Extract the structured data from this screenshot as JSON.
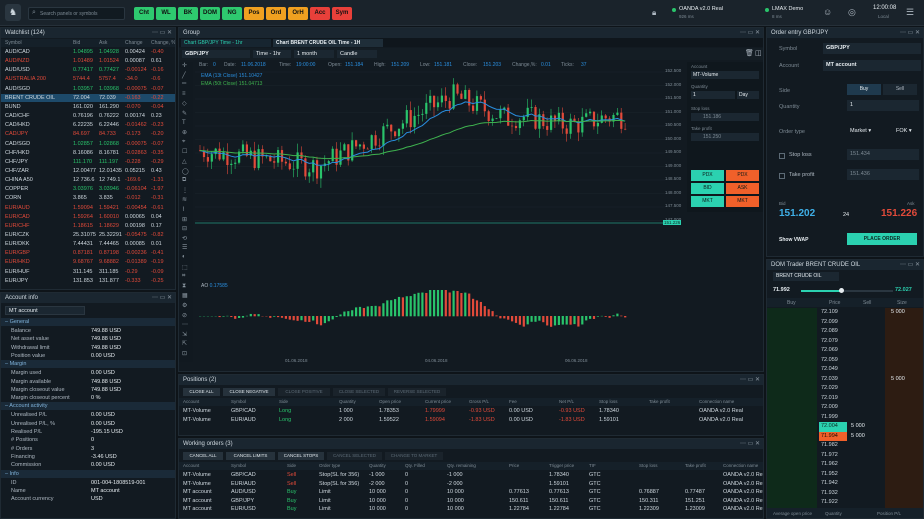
{
  "topbar": {
    "search_placeholder": "Search panels or symbols",
    "buttons": [
      {
        "label": "Cht",
        "color": "#2ec96f"
      },
      {
        "label": "WL",
        "color": "#2ec96f"
      },
      {
        "label": "BK",
        "color": "#2ec96f"
      },
      {
        "label": "DOM",
        "color": "#2ec96f"
      },
      {
        "label": "NG",
        "color": "#2ec96f"
      },
      {
        "label": "Pos",
        "color": "#f0a020"
      },
      {
        "label": "Ord",
        "color": "#f0a020"
      },
      {
        "label": "OrH",
        "color": "#f0a020"
      },
      {
        "label": "Acc",
        "color": "#e8403a"
      },
      {
        "label": "Sym",
        "color": "#e8403a"
      }
    ],
    "conn1": {
      "name": "OANDA v2.0 Real",
      "sub": "926 ms"
    },
    "conn2": {
      "name": "LMAX Demo",
      "sub": "8 ms"
    },
    "time": "12:00:08",
    "time_sub": "Local"
  },
  "watchlist": {
    "title": "Watchlist (124)",
    "cols": [
      "Symbol",
      "Bid",
      "Ask",
      "Change",
      "Change, %"
    ],
    "rows": [
      [
        "AUD/CAD",
        "1.04895",
        "1.04928",
        "0.00424",
        "-0.40",
        "g"
      ],
      [
        "AUD/NZD",
        "1.01489",
        "1.01524",
        "0.00087",
        "0.61",
        "r"
      ],
      [
        "AUD/USD",
        "0.77417",
        "0.77427",
        "-0.00124",
        "-0.16",
        "g"
      ],
      [
        "AUSTRALIA 200",
        "5744.4",
        "5757.4",
        "-34.0",
        "-0.6",
        "r"
      ],
      [
        "AUD/SGD",
        "1.03957",
        "1.03968",
        "-0.00075",
        "-0.07",
        "g"
      ],
      [
        "BRENT CRUDE OIL",
        "72.004",
        "72.039",
        "-0.163",
        "-0.22",
        "h"
      ],
      [
        "BUND",
        "161.020",
        "161.290",
        "-0.070",
        "-0.04",
        "n"
      ],
      [
        "CAD/CHF",
        "0.76196",
        "0.76222",
        "0.00174",
        "0.23",
        "n"
      ],
      [
        "CAD/HKD",
        "6.22235",
        "6.22446",
        "-0.01462",
        "-0.23",
        "n"
      ],
      [
        "CAD/JPY",
        "84.697",
        "84.733",
        "-0.173",
        "-0.20",
        "r"
      ],
      [
        "CAD/SGD",
        "1.02857",
        "1.02868",
        "-0.00075",
        "-0.07",
        "g"
      ],
      [
        "CHF/HKD",
        "8.16086",
        "8.16781",
        "-0.02863",
        "-0.35",
        "n"
      ],
      [
        "CHF/JPY",
        "111.170",
        "111.197",
        "-0.228",
        "-0.29",
        "g"
      ],
      [
        "CHF/ZAR",
        "12.00477",
        "12.01435",
        "0.05215",
        "0.43",
        "n"
      ],
      [
        "CHINA A50",
        "12 736.6",
        "12 749.1",
        "-169.6",
        "-1.31",
        "n"
      ],
      [
        "COPPER",
        "3.03976",
        "3.03946",
        "-0.06104",
        "-1.97",
        "g"
      ],
      [
        "CORN",
        "3.865",
        "3.835",
        "-0.012",
        "-0.31",
        "n"
      ],
      [
        "EUR/AUD",
        "1.59094",
        "1.59421",
        "-0.00454",
        "-0.61",
        "r"
      ],
      [
        "EUR/CAD",
        "1.59264",
        "1.60010",
        "0.00065",
        "0.04",
        "r"
      ],
      [
        "EUR/CHF",
        "1.18615",
        "1.18629",
        "0.00198",
        "0.17",
        "r"
      ],
      [
        "EUR/CZK",
        "25.31075",
        "25.32291",
        "-0.05475",
        "-0.82",
        "n"
      ],
      [
        "EUR/DKK",
        "7.44431",
        "7.44465",
        "0.00085",
        "0.01",
        "n"
      ],
      [
        "EUR/GBP",
        "0.87181",
        "0.87198",
        "-0.00236",
        "-0.41",
        "r"
      ],
      [
        "EUR/HKD",
        "9.68767",
        "9.68882",
        "-0.01389",
        "-0.19",
        "r"
      ],
      [
        "EUR/HUF",
        "311.145",
        "311.185",
        "-0.29",
        "-0.09",
        "n"
      ],
      [
        "EUR/JPY",
        "131.853",
        "131.877",
        "-0.333",
        "-0.25",
        "n"
      ]
    ]
  },
  "account": {
    "title": "Account info",
    "selector": "MT account",
    "sections": [
      {
        "name": "General",
        "rows": [
          [
            "Balance",
            "749.88 USD"
          ],
          [
            "Net asset value",
            "749.88 USD"
          ],
          [
            "Withdrawal limit",
            "749.88 USD"
          ],
          [
            "Position value",
            "0.00 USD"
          ]
        ]
      },
      {
        "name": "Margin",
        "rows": [
          [
            "Margin used",
            "0.00 USD"
          ],
          [
            "Margin available",
            "749.88 USD"
          ],
          [
            "Margin closeout value",
            "749.88 USD"
          ],
          [
            "Margin closeout percent",
            "0 %"
          ]
        ]
      },
      {
        "name": "Account activity",
        "rows": [
          [
            "Unrealised P/L",
            "0.00 USD"
          ],
          [
            "Unrealised P/L, %",
            "0.00 USD"
          ],
          [
            "Realised P/L",
            "-195.15 USD"
          ],
          [
            "# Positions",
            "0"
          ],
          [
            "# Orders",
            "3"
          ],
          [
            "Financing",
            "-3.46 USD"
          ],
          [
            "Commission",
            "0.00 USD"
          ]
        ]
      },
      {
        "name": "Info",
        "rows": [
          [
            "ID",
            "001-004-1808519-001"
          ],
          [
            "Name",
            "MT account"
          ],
          [
            "Account currency",
            "USD"
          ]
        ]
      }
    ]
  },
  "group": {
    "title": "Group",
    "tab1": "Chart GBP/JPY Time - 1hr",
    "tab2": "Chart BRENT CRUDE OIL Time - 1H",
    "symbol": "GBP/JPY",
    "timeframe": "Time - 1hr",
    "range": "1 month",
    "style": "Candle",
    "info": [
      [
        "Bar:",
        "0"
      ],
      [
        "Date:",
        "11.06.2018"
      ],
      [
        "Time:",
        "19:00:00"
      ],
      [
        "Open:",
        "151.184"
      ],
      [
        "High:",
        "151.209"
      ],
      [
        "Low:",
        "151.181"
      ],
      [
        "Close:",
        "151.203"
      ],
      [
        "Change,%:",
        "0.01"
      ],
      [
        "Ticks:",
        "37"
      ]
    ],
    "ema1": "EMA (13t Close)",
    "ema1v": "151.10427",
    "ema2": "EMA (50t Close)",
    "ema2v": "151.04713",
    "ao": "AO",
    "aov": "0.17585",
    "prices": [
      "152.500",
      "152.000",
      "151.500",
      "151.000",
      "150.500",
      "150.000",
      "149.500",
      "149.000",
      "148.500",
      "148.000",
      "147.500",
      "147.000"
    ],
    "price_tag": "151.226",
    "xticks": [
      "01.06.2018",
      "04.06.2018",
      "06.06.2018"
    ]
  },
  "order_side": {
    "account": "MT account",
    "volume": "MT-Volume",
    "qty": "1",
    "tif": "Day",
    "sl": "151.186",
    "tp": "151.250",
    "buttons": [
      [
        "PDX",
        "green"
      ],
      [
        "PDX",
        "red"
      ],
      [
        "BID",
        "green"
      ],
      [
        "ASK",
        "red"
      ],
      [
        "MKT",
        "green"
      ],
      [
        "MKT",
        "red"
      ]
    ]
  },
  "order_entry": {
    "title": "Order entry GBP/JPY",
    "symbol_label": "Symbol",
    "symbol": "GBP/JPY",
    "account_label": "Account",
    "account": "MT account",
    "side_label": "Side",
    "buy": "Buy",
    "sell": "Sell",
    "qty_label": "Quantity",
    "qty": "1",
    "type_label": "Order type",
    "type": "Market",
    "tif": "FOK",
    "sl_label": "Stop loss",
    "sl": "151.434",
    "tp_label": "Take profit",
    "tp": "151.436",
    "bid_label": "Bid",
    "bid": "151.202",
    "spread": "24",
    "ask_label": "Ask",
    "ask": "151.226",
    "show_vwap": "Show VWAP",
    "place": "PLACE ORDER"
  },
  "dom": {
    "title": "DOM Trader BRENT CRUDE OIL",
    "symbol": "BRENT CRUDE OIL",
    "bid": "71.992",
    "ask": "72.027",
    "cols": [
      "Buy",
      "Price",
      "Sell",
      "Size"
    ],
    "rows": [
      [
        "72.109",
        "5 000"
      ],
      [
        "72.099",
        ""
      ],
      [
        "72.089",
        ""
      ],
      [
        "72.079",
        ""
      ],
      [
        "72.069",
        ""
      ],
      [
        "72.059",
        ""
      ],
      [
        "72.049",
        ""
      ],
      [
        "72.039",
        "5 000"
      ],
      [
        "72.029",
        ""
      ],
      [
        "72.019",
        ""
      ],
      [
        "72.009",
        ""
      ],
      [
        "71.999",
        ""
      ],
      [
        "72.004",
        "5 000",
        "bidmark"
      ],
      [
        "71.994",
        "5 000",
        "buy"
      ],
      [
        "71.982",
        ""
      ],
      [
        "71.972",
        ""
      ],
      [
        "71.962",
        ""
      ],
      [
        "71.952",
        ""
      ],
      [
        "71.942",
        ""
      ],
      [
        "71.932",
        ""
      ],
      [
        "71.922",
        ""
      ]
    ],
    "footer": [
      "Average open price",
      "Quantity",
      "Position P/L"
    ]
  },
  "positions": {
    "title": "Positions (2)",
    "buttons": [
      "CLOSE ALL",
      "CLOSE NEGATIVE",
      "CLOSE POSITIVE",
      "CLOSE SELECTED",
      "REVERSE SELECTED"
    ],
    "cols": [
      "Account",
      "Symbol",
      "Side",
      "Quantity",
      "Open price",
      "Current price",
      "Gross P/L",
      "Fee",
      "Net P/L",
      "Stop loss",
      "Take profit",
      "Connection name"
    ],
    "rows": [
      [
        "MT-Volume",
        "GBP/CAD",
        "Long",
        "1 000",
        "1.78353",
        "1.79999",
        "-0.93 USD",
        "0.00 USD",
        "-0.93 USD",
        "1.78340",
        "",
        "OANDA v2.0 Real"
      ],
      [
        "MT-Volume",
        "EUR/AUD",
        "Long",
        "2 000",
        "1.59522",
        "1.59094",
        "-1.83 USD",
        "0.00 USD",
        "-1.83 USD",
        "1.59101",
        "",
        "OANDA v2.0 Real"
      ]
    ]
  },
  "working": {
    "title": "Working orders (3)",
    "buttons": [
      "CANCEL ALL",
      "CANCEL LIMITS",
      "CANCEL STOPS",
      "CANCEL SELECTED",
      "CHANGE TO MARKET"
    ],
    "cols": [
      "Account",
      "Symbol",
      "Side",
      "Order type",
      "Quantity",
      "Qty. Filled",
      "Qty. remaining",
      "Price",
      "Trigger price",
      "TIF",
      "Stop loss",
      "Take profit",
      "Connection name"
    ],
    "rows": [
      [
        "MT-Volume",
        "GBP/CAD",
        "Sell",
        "Stop(SL for 356)",
        "-1 000",
        "0",
        "-1 000",
        "",
        "1.78340",
        "GTC",
        "",
        "",
        "OANDA v2.0 Real"
      ],
      [
        "MT-Volume",
        "EUR/AUD",
        "Sell",
        "Stop(SL for 356)",
        "-2 000",
        "0",
        "-2 000",
        "",
        "1.59101",
        "GTC",
        "",
        "",
        "OANDA v2.0 Real"
      ],
      [
        "MT account",
        "AUD/USD",
        "Buy",
        "Limit",
        "10 000",
        "0",
        "10 000",
        "0.77613",
        "0.77613",
        "GTC",
        "0.76887",
        "0.77487",
        "OANDA v2.0 Real"
      ],
      [
        "MT account",
        "GBP/JPY",
        "Buy",
        "Limit",
        "10 000",
        "0",
        "10 000",
        "150.611",
        "150.611",
        "GTC",
        "150.311",
        "151.251",
        "OANDA v2.0 Real"
      ],
      [
        "MT account",
        "EUR/USD",
        "Buy",
        "Limit",
        "10 000",
        "0",
        "10 000",
        "1.22784",
        "1.22784",
        "GTC",
        "1.22309",
        "1.23009",
        "OANDA v2.0 Real"
      ]
    ]
  },
  "colors": {
    "green": "#29c46b",
    "red": "#e24a3a",
    "accent": "#2bd1b0",
    "ema1": "#2a8fe0",
    "ema2": "#3fb34f"
  }
}
